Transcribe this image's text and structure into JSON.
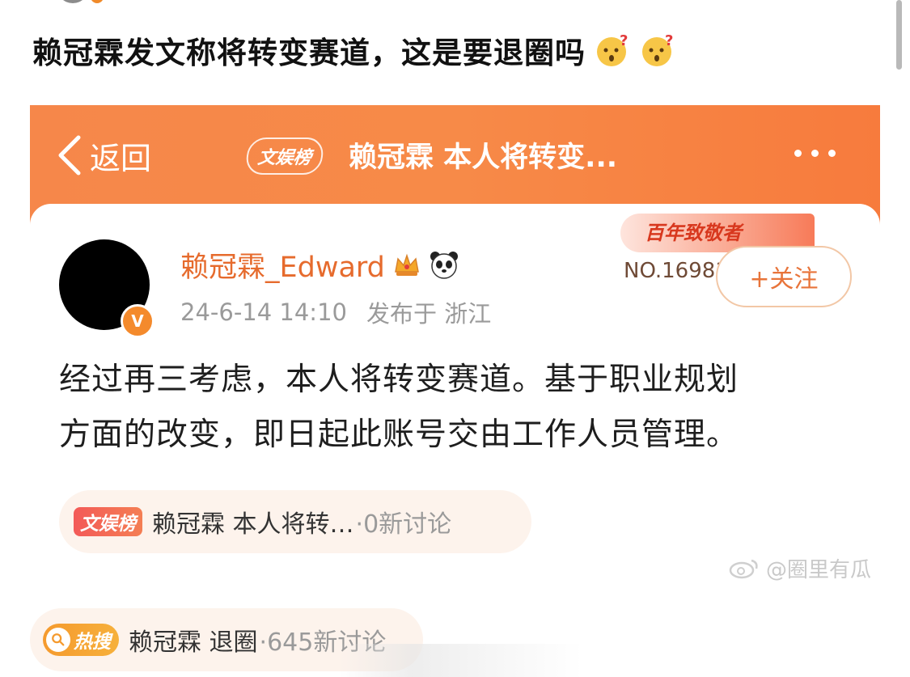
{
  "post": {
    "title": "赖冠霖发文称将转变赛道，这是要退圈吗",
    "emojis": [
      "thinking-face-icon",
      "thinking-face-icon"
    ]
  },
  "screenshot": {
    "nav": {
      "back_label": "返回",
      "tag": "文娱榜",
      "title": "赖冠霖 本人将转变..."
    },
    "user": {
      "name": "赖冠霖_Edward",
      "verified_mark": "V",
      "date": "24-6-14 14:10",
      "location": "发布于 浙江"
    },
    "rank": {
      "label": "百年致敬者",
      "number": "NO.16981"
    },
    "follow_label": "+关注",
    "body_line1": "经过再三考虑，本人将转变赛道。基于职业规划",
    "body_line2": "方面的改变，即日起此账号交由工作人员管理。",
    "topic": {
      "tag": "文娱榜",
      "text": "赖冠霖 本人将转…",
      "count": "·0新讨论"
    },
    "watermark": "@圈里有瓜"
  },
  "hot_search": {
    "tag": "热搜",
    "text": "赖冠霖 退圈",
    "count": "·645新讨论"
  },
  "colors": {
    "nav_orange": "#f6874a",
    "username_orange": "#e66b2d",
    "hot_tag": "#f59a2e",
    "topic_tag": "#f35a58"
  }
}
